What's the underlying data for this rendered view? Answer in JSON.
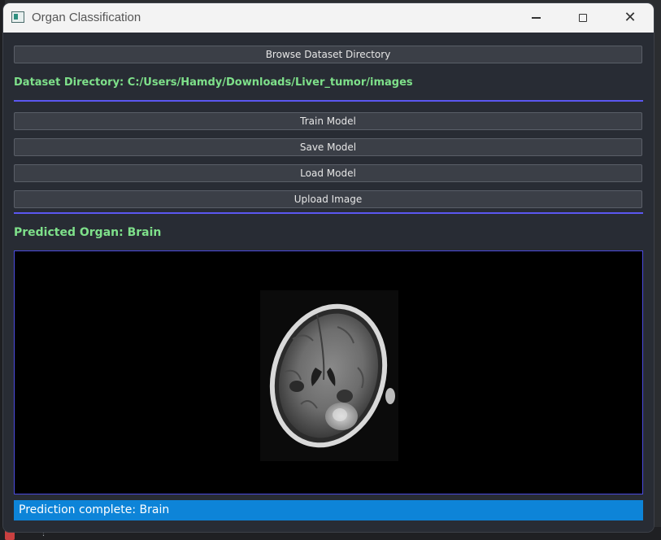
{
  "window": {
    "title": "Organ Classification"
  },
  "buttons": {
    "browse": "Browse Dataset Directory",
    "train": "Train Model",
    "save": "Save Model",
    "load": "Load Model",
    "upload": "Upload Image"
  },
  "dataset_label": "Dataset Directory: C:/Users/Hamdy/Downloads/Liver_tumor/images",
  "prediction_label": "Predicted Organ: Brain",
  "status": "Prediction complete: Brain",
  "colors": {
    "accent_divider": "#5b57f0",
    "label_green": "#7ee08a",
    "status_blue": "#0d84d8",
    "background": "#282c34"
  },
  "icons": {
    "app": "app-window-icon",
    "minimize": "minimize-icon",
    "maximize": "maximize-icon",
    "close": "close-icon"
  }
}
